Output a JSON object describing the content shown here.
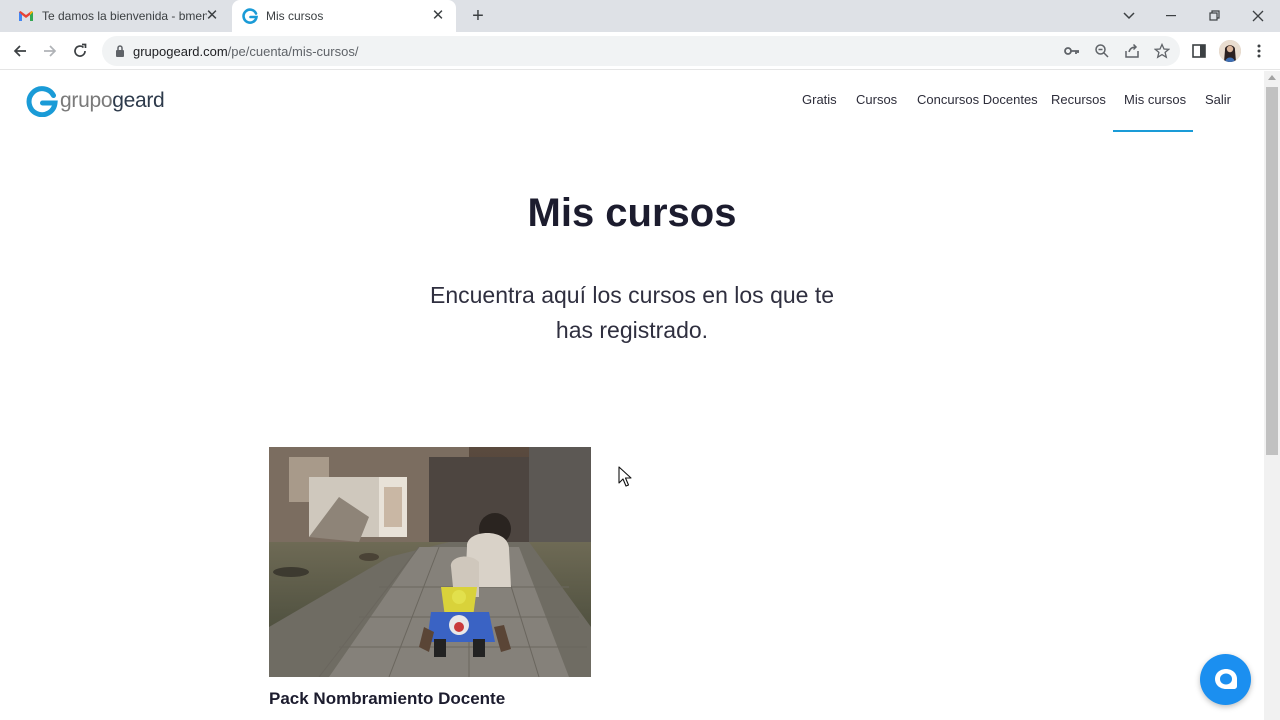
{
  "browser": {
    "tabs": [
      {
        "title": "Te damos la bienvenida - bmend",
        "favicon": "gmail-icon",
        "active": false
      },
      {
        "title": "Mis cursos",
        "favicon": "grupogeard-icon",
        "active": true
      }
    ],
    "url_host": "grupogeard.com",
    "url_path": "/pe/cuenta/mis-cursos/"
  },
  "site": {
    "logo_prefix": "grupo",
    "logo_suffix": "geard",
    "nav": [
      {
        "label": "Gratis",
        "active": false
      },
      {
        "label": "Cursos",
        "active": false
      },
      {
        "label": "Concursos Docentes",
        "active": false
      },
      {
        "label": "Recursos",
        "active": false
      },
      {
        "label": "Mis cursos",
        "active": true
      },
      {
        "label": "Salir",
        "active": false
      }
    ]
  },
  "main": {
    "title": "Mis cursos",
    "subtitle": "Encuentra aquí los cursos en los que te has registrado.",
    "courses": [
      {
        "title": "Pack Nombramiento Docente"
      }
    ]
  },
  "colors": {
    "accent": "#1a9bd7",
    "chat_button": "#1b8ff0",
    "heading": "#1c1c2e"
  }
}
